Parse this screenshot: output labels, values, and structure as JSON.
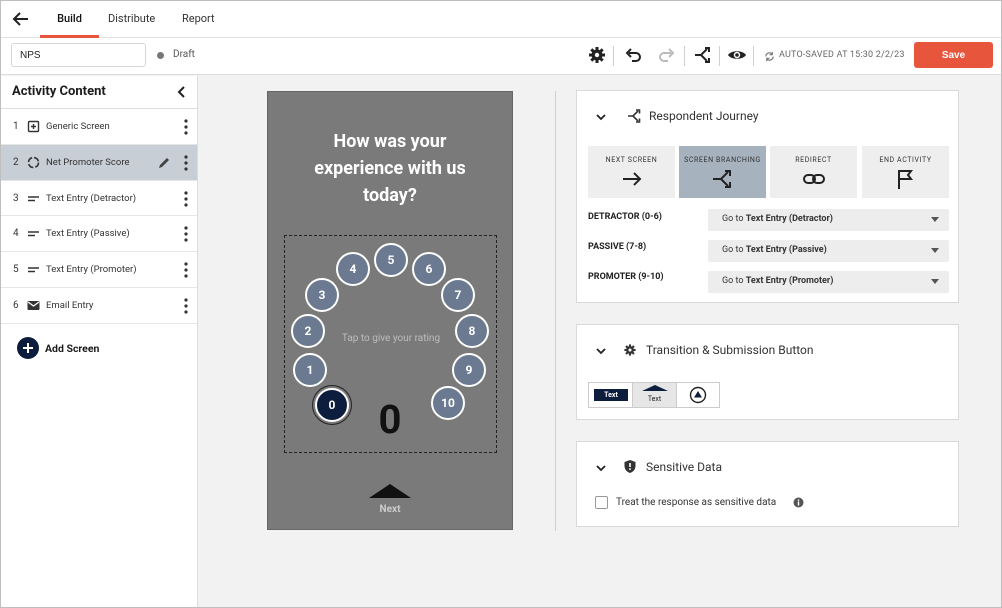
{
  "nav": {
    "tabs": [
      {
        "label": "Build",
        "active": true
      },
      {
        "label": "Distribute",
        "active": false
      },
      {
        "label": "Report",
        "active": false
      }
    ],
    "accent_color": "#e8553d"
  },
  "toolbar": {
    "activity_name": "NPS",
    "status": "Draft",
    "autosave_text": "AUTO-SAVED AT 15:30 2/2/23",
    "save_label": "Save",
    "icons": [
      "gear-icon",
      "undo-icon",
      "redo-icon",
      "branching-icon",
      "eye-icon",
      "sync-icon"
    ]
  },
  "sidebar": {
    "title": "Activity Content",
    "items": [
      {
        "num": "1",
        "label": "Generic Screen",
        "icon": "generic-screen-icon"
      },
      {
        "num": "2",
        "label": "Net Promoter Score",
        "icon": "nps-icon",
        "selected": true
      },
      {
        "num": "3",
        "label": "Text Entry (Detractor)",
        "icon": "text-entry-icon"
      },
      {
        "num": "4",
        "label": "Text Entry (Passive)",
        "icon": "text-entry-icon"
      },
      {
        "num": "5",
        "label": "Text Entry (Promoter)",
        "icon": "text-entry-icon"
      },
      {
        "num": "6",
        "label": "Email Entry",
        "icon": "email-icon"
      }
    ],
    "add_label": "Add Screen"
  },
  "preview": {
    "question": "How was your experience with us today?",
    "hint": "Tap to give your rating",
    "scale": [
      "0",
      "1",
      "2",
      "3",
      "4",
      "5",
      "6",
      "7",
      "8",
      "9",
      "10"
    ],
    "selected_value": "0",
    "next_label": "Next"
  },
  "journey": {
    "title": "Respondent Journey",
    "routes": [
      {
        "label": "NEXT SCREEN",
        "icon": "arrow-right-icon"
      },
      {
        "label": "SCREEN BRANCHING",
        "icon": "branching-icon",
        "active": true
      },
      {
        "label": "REDIRECT",
        "icon": "link-icon"
      },
      {
        "label": "END ACTIVITY",
        "icon": "flag-icon"
      }
    ],
    "branches": [
      {
        "label": "DETRACTOR (0-6)",
        "prefix": "Go to",
        "target": "Text Entry (Detractor)"
      },
      {
        "label": "PASSIVE (7-8)",
        "prefix": "Go to",
        "target": "Text Entry (Passive)"
      },
      {
        "label": "PROMOTER (9-10)",
        "prefix": "Go to",
        "target": "Text Entry (Promoter)"
      }
    ]
  },
  "transition": {
    "title": "Transition & Submission Button",
    "options": [
      {
        "label": "Text"
      },
      {
        "label": "Text",
        "active": true
      },
      {
        "label": "",
        "icon": "circle-arrow-icon"
      }
    ]
  },
  "sensitive": {
    "title": "Sensitive Data",
    "checkbox_label": "Treat the response as sensitive data",
    "checked": false
  }
}
